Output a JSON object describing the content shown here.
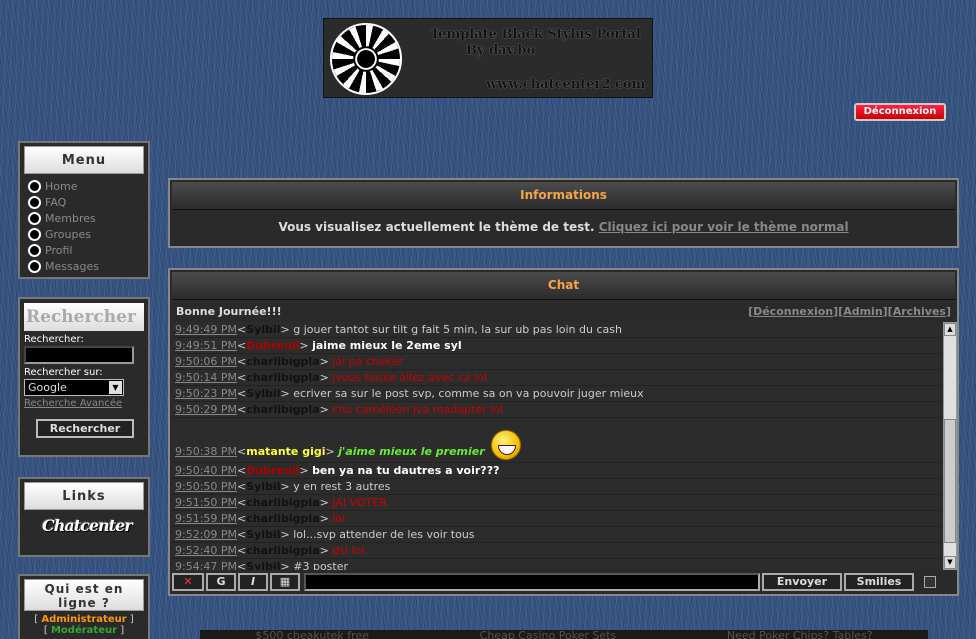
{
  "banner": {
    "line1": "Template Black Stylus Portal",
    "line2": "By dav.bo",
    "line3": "www.chatcenter2.com"
  },
  "header": {
    "logout_label": "Déconnexion"
  },
  "menu": {
    "title": "Menu",
    "items": [
      "Home",
      "FAQ",
      "Membres",
      "Groupes",
      "Profil",
      "Messages"
    ]
  },
  "search": {
    "title": "Rechercher",
    "label_query": "Rechercher:",
    "label_on": "Rechercher sur:",
    "engine_selected": "Google",
    "advanced_link": "Recherche Avancée",
    "button_label": "Rechercher"
  },
  "links": {
    "title": "Links",
    "logo_text": "Chatcenter"
  },
  "online": {
    "title": "Qui est en ligne ?",
    "admin": "Administrateur",
    "moderator": "Modérateur"
  },
  "info": {
    "title": "Informations",
    "message": "Vous visualisez actuellement le thème de test. ",
    "link": "Cliquez ici pour voir le thème normal"
  },
  "chat": {
    "title": "Chat",
    "greeting": "Bonne Journée!!!",
    "link_logout": "Déconnexion",
    "link_admin": "Admin",
    "link_archives": "Archives",
    "messages": [
      {
        "time": "9:49:49 PM",
        "nick": "Sylbil",
        "nick_color": "#111111",
        "text": "g jouer tantot sur tilt g fait 5 min, la sur ub pas loin du cash",
        "text_color": "#cccccc",
        "bold": false,
        "italic": false
      },
      {
        "time": "9:49:51 PM",
        "nick": "Dubreuil",
        "nick_color": "#b00000",
        "text": "jaime mieux le 2eme syl",
        "text_color": "#ffffff",
        "bold": true,
        "italic": false
      },
      {
        "time": "9:50:06 PM",
        "nick": "charlibigpla",
        "nick_color": "#111111",
        "text": "jai pa cheker",
        "text_color": "#cc0000",
        "bold": false,
        "italic": false
      },
      {
        "time": "9:50:14 PM",
        "nick": "charlibigpla",
        "nick_color": "#111111",
        "text": "jvous laisse allez avec ca lol",
        "text_color": "#cc0000",
        "bold": false,
        "italic": false
      },
      {
        "time": "9:50:23 PM",
        "nick": "Sylbil",
        "nick_color": "#111111",
        "text": "ecriver sa sur le post svp, comme sa on va pouvoir juger mieux",
        "text_color": "#cccccc",
        "bold": false,
        "italic": false
      },
      {
        "time": "9:50:29 PM",
        "nick": "charlibigpla",
        "nick_color": "#111111",
        "text": "chu caméléon jva madapter lol",
        "text_color": "#cc0000",
        "bold": false,
        "italic": false
      },
      {
        "time": "9:50:38 PM",
        "nick": "matante gigi",
        "nick_color": "#ffff33",
        "text": "j'aime mieux le premier",
        "text_color": "#66ee33",
        "bold": true,
        "italic": true,
        "smiley": true
      },
      {
        "time": "9:50:40 PM",
        "nick": "Dubreuil",
        "nick_color": "#b00000",
        "text": "ben ya na tu dautres a voir???",
        "text_color": "#ffffff",
        "bold": true,
        "italic": false
      },
      {
        "time": "9:50:50 PM",
        "nick": "Sylbil",
        "nick_color": "#111111",
        "text": "y en rest 3 autres",
        "text_color": "#cccccc",
        "bold": false,
        "italic": false
      },
      {
        "time": "9:51:50 PM",
        "nick": "charlibigpla",
        "nick_color": "#111111",
        "text": "JAI VOTER",
        "text_color": "#cc0000",
        "bold": false,
        "italic": false
      },
      {
        "time": "9:51:59 PM",
        "nick": "charlibigpla",
        "nick_color": "#111111",
        "text": "lol",
        "text_color": "#cc0000",
        "bold": false,
        "italic": false
      },
      {
        "time": "9:52:09 PM",
        "nick": "Sylbil",
        "nick_color": "#111111",
        "text": "lol...svp attender de les voir tous",
        "text_color": "#cccccc",
        "bold": false,
        "italic": false
      },
      {
        "time": "9:52:40 PM",
        "nick": "charlibigpla",
        "nick_color": "#111111",
        "text": "dsl lol",
        "text_color": "#cc0000",
        "bold": false,
        "italic": false
      },
      {
        "time": "9:54:47 PM",
        "nick": "Sylbil",
        "nick_color": "#111111",
        "text": "#3 poster",
        "text_color": "#cccccc",
        "bold": false,
        "italic": false
      }
    ],
    "toolbar": {
      "bold_label": "G",
      "italic_label": "I",
      "send_label": "Envoyer",
      "smilies_label": "Smilies"
    }
  },
  "footer": {
    "items": [
      "$500 cheakutek free",
      "Cheap Casino Poker Sets",
      "Need Poker Chips? Tables?"
    ]
  },
  "colors": {
    "background": "#34507e",
    "panel": "#2a2a2a",
    "accent": "#f7a34a"
  }
}
